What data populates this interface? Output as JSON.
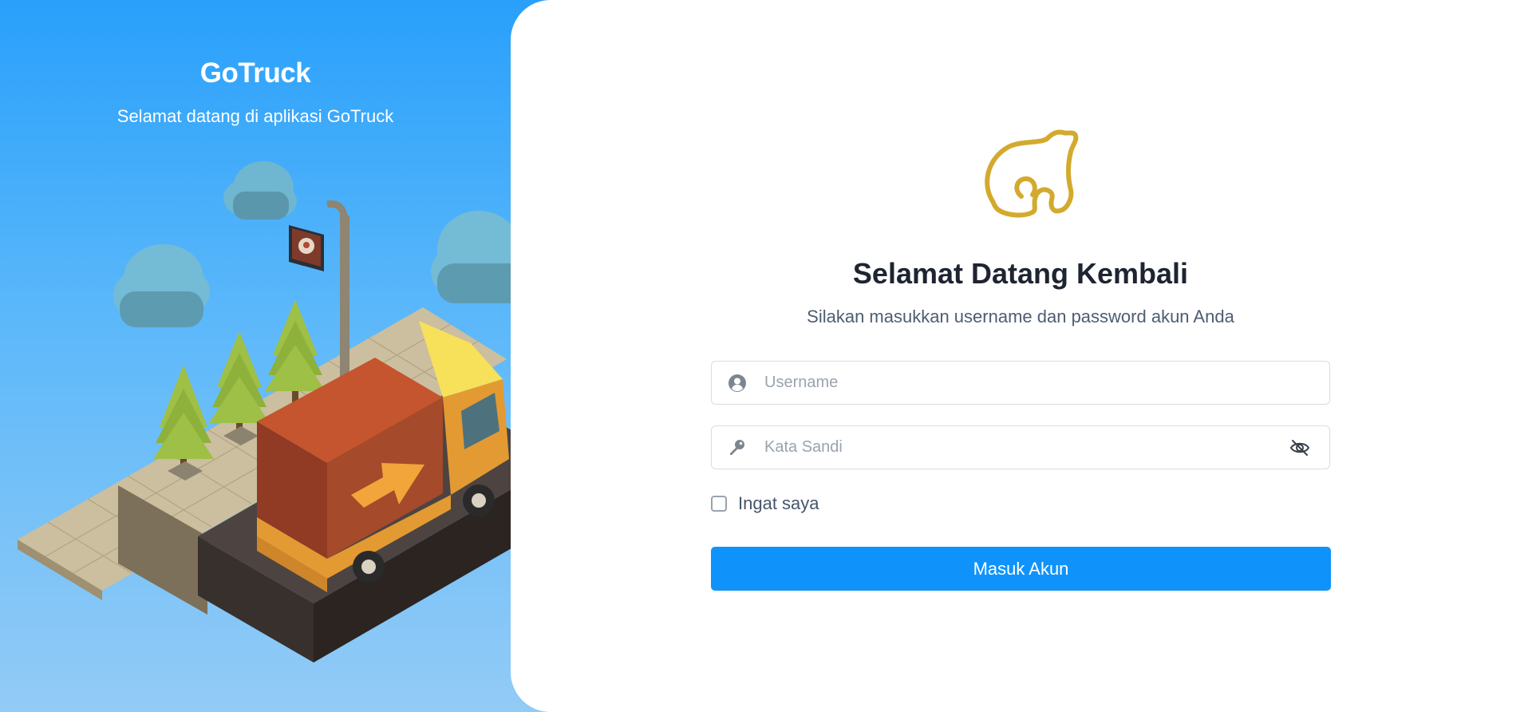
{
  "hero": {
    "title": "GoTruck",
    "subtitle": "Selamat datang di aplikasi GoTruck"
  },
  "login": {
    "title": "Selamat Datang Kembali",
    "subtitle": "Silakan masukkan username dan password akun Anda",
    "username_placeholder": "Username",
    "username_value": "",
    "password_placeholder": "Kata Sandi",
    "password_value": "",
    "remember_label": "Ingat saya",
    "remember_checked": false,
    "submit_label": "Masuk Akun"
  },
  "icons": {
    "logo": "bear-logo-icon",
    "username": "user-circle-icon",
    "password": "key-icon",
    "visibility": "eye-slash-icon"
  },
  "colors": {
    "hero_top": "#29a0fb",
    "hero_bottom": "#93cbf6",
    "accent": "#0f93fb",
    "logo_gold": "#d3aa2e",
    "title_text": "#1e2430"
  }
}
